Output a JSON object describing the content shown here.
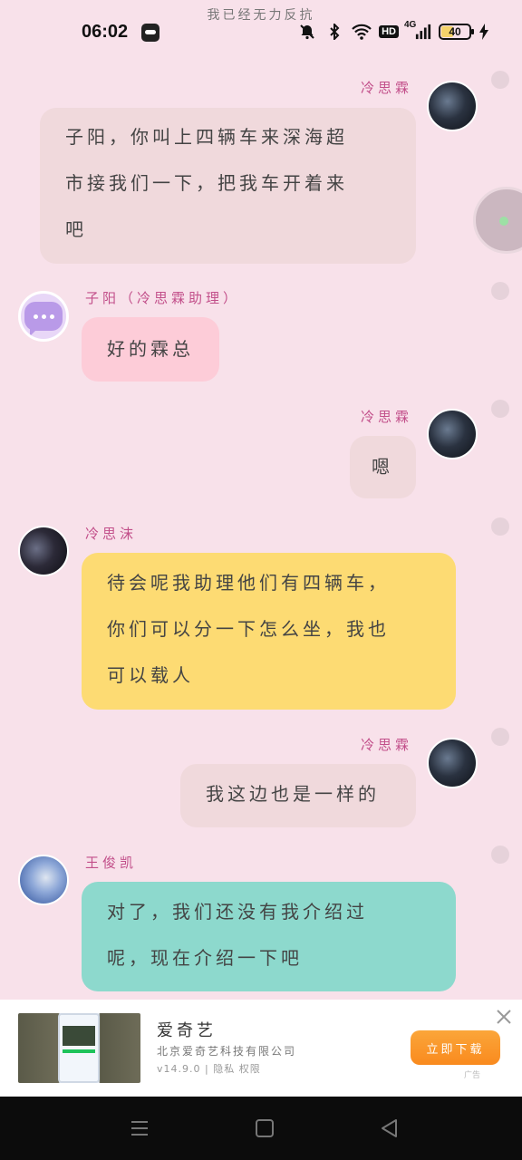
{
  "status_bar": {
    "top_note": "我已经无力反抗",
    "time": "06:02",
    "hd": "HD",
    "network": "4G",
    "battery": "40"
  },
  "messages": [
    {
      "sender": "冷思霖",
      "text_lines": [
        "子阳，你叫上四辆车来深海超",
        "市接我们一下，把我车开着来",
        "吧"
      ]
    },
    {
      "sender": "子阳（冷思霖助理）",
      "text_lines": [
        "好的霖总"
      ]
    },
    {
      "sender": "冷思霖",
      "text_lines": [
        "嗯"
      ]
    },
    {
      "sender": "冷思沫",
      "text_lines": [
        "待会呢我助理他们有四辆车，",
        "你们可以分一下怎么坐，我也",
        "可以载人"
      ]
    },
    {
      "sender": "冷思霖",
      "text_lines": [
        "我这边也是一样的"
      ]
    },
    {
      "sender": "王俊凯",
      "text_lines": [
        "对了，我们还没有我介绍过",
        "呢，现在介绍一下吧"
      ]
    }
  ],
  "ad": {
    "title": "爱奇艺",
    "subtitle": "北京爱奇艺科技有限公司",
    "meta": "v14.9.0 | 隐私 权限",
    "button": "立即下载",
    "tag": "广告"
  },
  "colors": {
    "background": "#f8e1ea",
    "name": "#c24f8a",
    "bubble_gray": "#f0d9dc",
    "bubble_pink": "#fdccd8",
    "bubble_yellow": "#fddb73",
    "bubble_teal": "#8dd9cd",
    "ad_button": "#f98a1e"
  }
}
